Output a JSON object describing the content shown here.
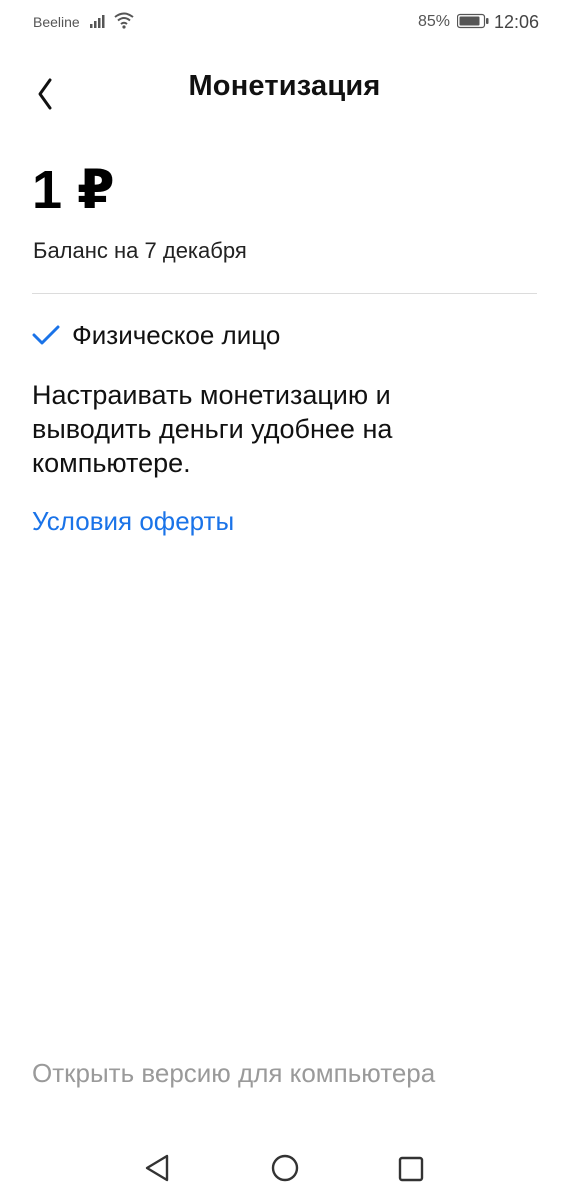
{
  "status_bar": {
    "carrier": "Beeline",
    "battery": "85%",
    "time": "12:06",
    "icons": [
      "signal-icon",
      "wifi-icon",
      "battery-icon"
    ]
  },
  "header": {
    "title": "Монетизация",
    "back_icon": "chevron-left-icon"
  },
  "balance": {
    "amount": "1 ₽",
    "caption": "Баланс на 7 декабря"
  },
  "status": {
    "icon": "check-icon",
    "label": "Физическое лицо"
  },
  "info": {
    "text": "Настраивать монетизацию и выводить деньги удобнее на компьютере."
  },
  "links": {
    "offer": "Условия оферты",
    "desktop": "Открыть версию для компьютера"
  },
  "nav_bar": {
    "icons": [
      "back-triangle-icon",
      "home-circle-icon",
      "recents-square-icon"
    ]
  },
  "colors": {
    "accent": "#1a73e8",
    "muted": "#9a9a9a",
    "text": "#111111"
  }
}
